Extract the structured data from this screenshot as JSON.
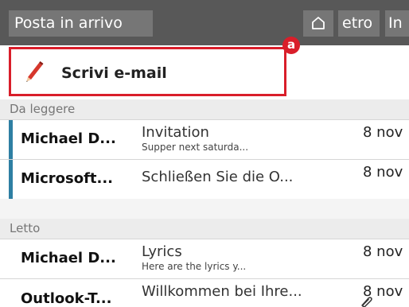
{
  "toolbar": {
    "inbox_label": "Posta in arrivo",
    "home_icon": "home-icon",
    "back_label": "etro",
    "in_label": "In"
  },
  "compose": {
    "icon": "pencil-icon",
    "label": "Scrivi e-mail",
    "badge": "a"
  },
  "sections": [
    {
      "title": "Da leggere",
      "emails": [
        {
          "sender": "Michael D...",
          "subject": "Invitation",
          "preview": "Supper next saturda...",
          "date": "8 nov",
          "unread": true
        },
        {
          "sender": "Microsoft...",
          "subject": "Schließen Sie die O...",
          "preview": "",
          "date": "8 nov",
          "unread": true
        }
      ]
    },
    {
      "title": "Letto",
      "emails": [
        {
          "sender": "Michael D...",
          "subject": "Lyrics",
          "preview": "Here are the lyrics y...",
          "date": "8 nov",
          "unread": false
        },
        {
          "sender": "Outlook-T...",
          "subject": "Willkommen bei Ihre...",
          "preview": "",
          "date": "8 nov",
          "unread": false,
          "attachment_icon": "paperclip-icon"
        }
      ]
    }
  ],
  "colors": {
    "toolbar": "#585858",
    "accent_red": "#d91e2a",
    "unread_bar": "#2e7fa3"
  }
}
